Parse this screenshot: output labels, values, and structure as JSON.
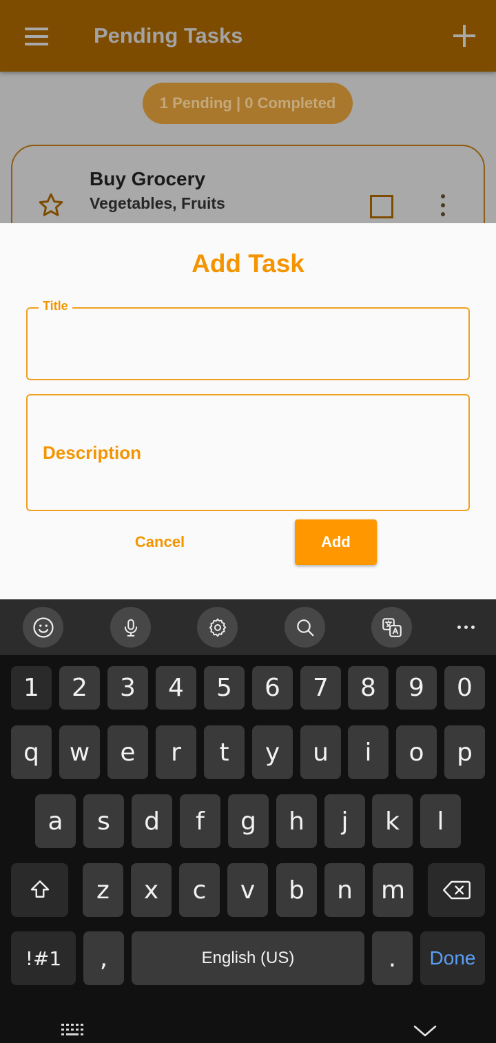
{
  "app": {
    "title": "Pending Tasks",
    "status": "1 Pending | 0 Completed",
    "task": {
      "title": "Buy Grocery",
      "description": "Vegetables,  Fruits",
      "starred": false,
      "completed": false
    }
  },
  "dialog": {
    "title": "Add Task",
    "title_field": {
      "label": "Title",
      "value": ""
    },
    "description_field": {
      "placeholder": "Description",
      "value": ""
    },
    "cancel_label": "Cancel",
    "add_label": "Add"
  },
  "keyboard": {
    "toolbar": [
      "emoji-icon",
      "microphone-icon",
      "settings-icon",
      "search-icon",
      "translate-icon",
      "more-icon"
    ],
    "number_row": [
      "1",
      "2",
      "3",
      "4",
      "5",
      "6",
      "7",
      "8",
      "9",
      "0"
    ],
    "row1": [
      "q",
      "w",
      "e",
      "r",
      "t",
      "y",
      "u",
      "i",
      "o",
      "p"
    ],
    "row2": [
      "a",
      "s",
      "d",
      "f",
      "g",
      "h",
      "j",
      "k",
      "l"
    ],
    "row3": [
      "z",
      "x",
      "c",
      "v",
      "b",
      "n",
      "m"
    ],
    "symbols_label": "!#1",
    "comma_label": ",",
    "space_label": "English (US)",
    "period_label": ".",
    "done_label": "Done"
  },
  "colors": {
    "accent": "#ff9800",
    "appbar_dimmed": "#7e4c00",
    "keyboard_bg": "#111111",
    "key_bg": "#3a3a3a",
    "done_text": "#5a9ff5"
  }
}
